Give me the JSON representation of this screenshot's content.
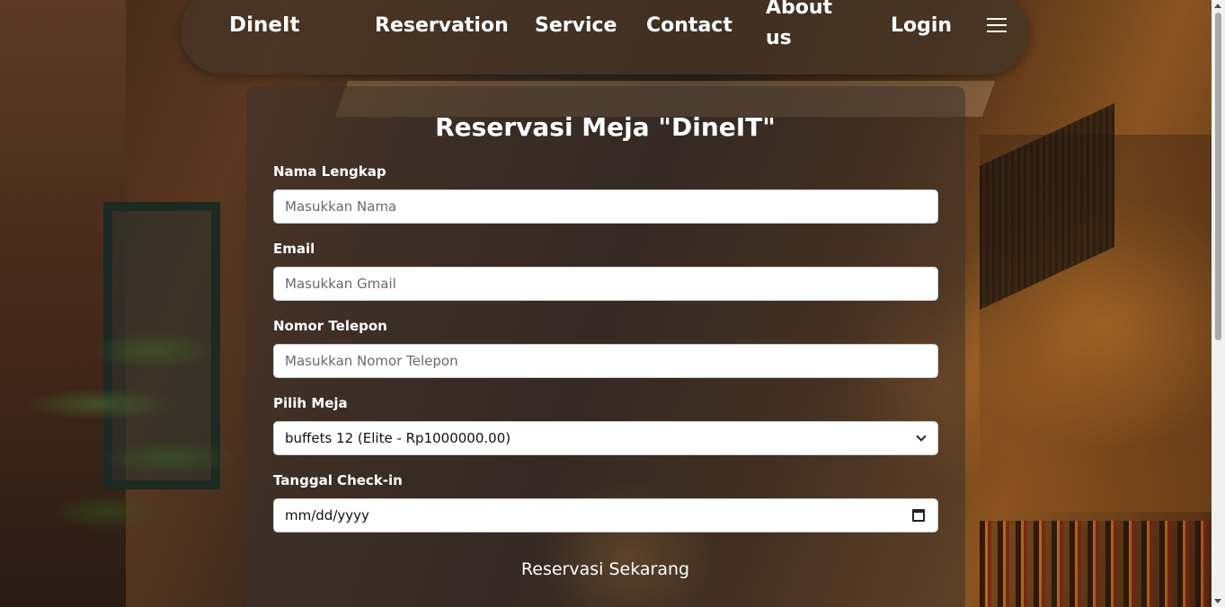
{
  "navbar": {
    "brand": "DineIt",
    "links": [
      "Reservation",
      "Service",
      "Contact",
      "About us",
      "Login"
    ],
    "menu_icon": "hamburger-menu-icon"
  },
  "form": {
    "title": "Reservasi Meja \"DineIT\"",
    "fields": {
      "name": {
        "label": "Nama Lengkap",
        "placeholder": "Masukkan Nama"
      },
      "email": {
        "label": "Email",
        "placeholder": "Masukkan Gmail"
      },
      "phone": {
        "label": "Nomor Telepon",
        "placeholder": "Masukkan Nomor Telepon"
      },
      "table": {
        "label": "Pilih Meja",
        "selected": "buffets 12 (Elite - Rp1000000.00)"
      },
      "checkin": {
        "label": "Tanggal Check-in",
        "placeholder": "mm/dd/yyyy"
      }
    },
    "submit_label": "Reservasi Sekarang"
  },
  "icons": {
    "select": "chevron-down-icon",
    "date": "calendar-icon"
  }
}
